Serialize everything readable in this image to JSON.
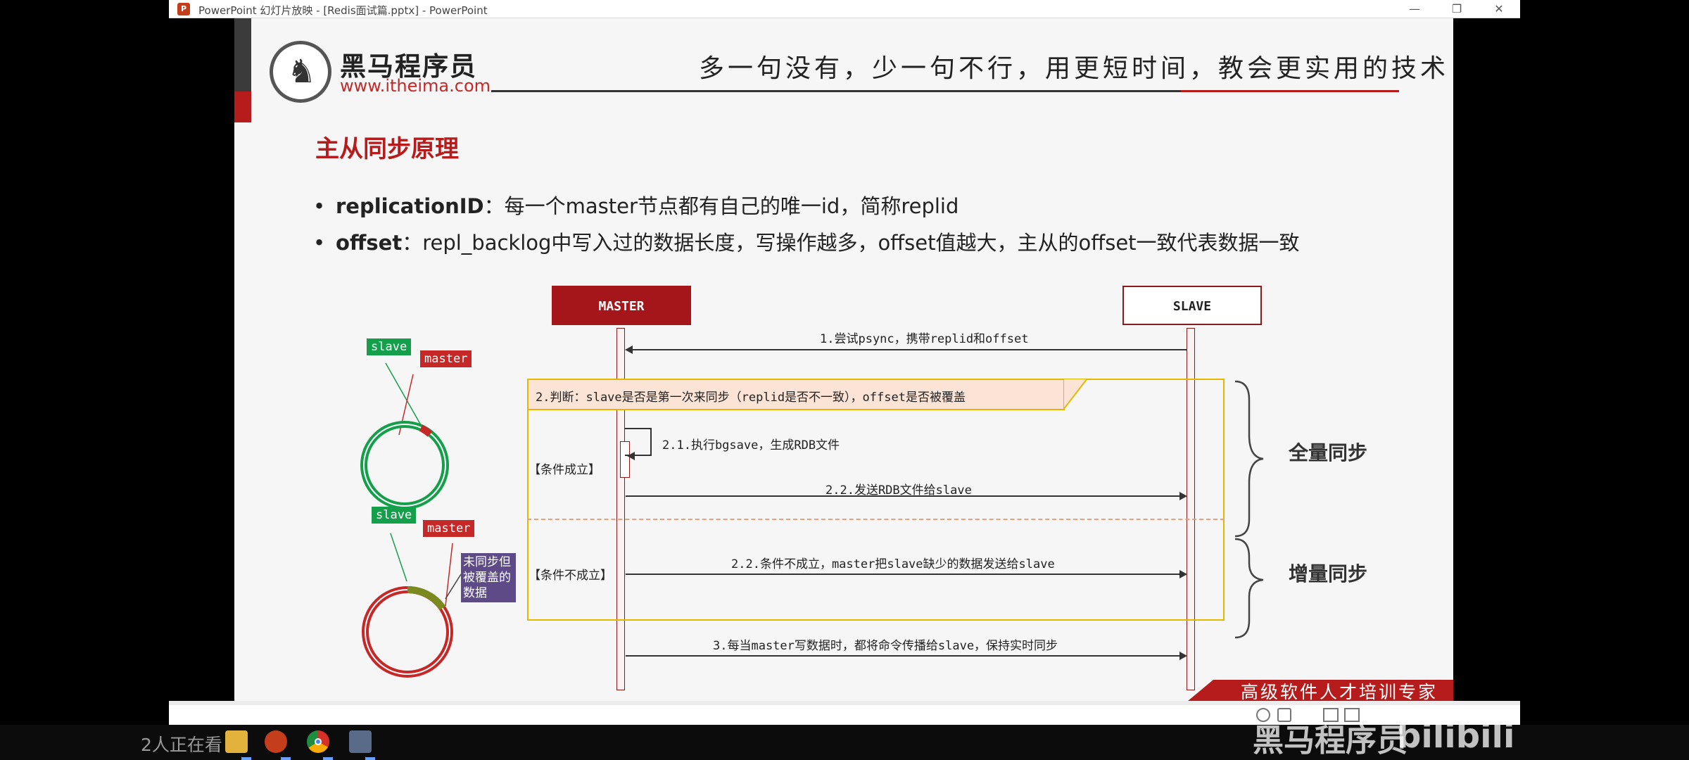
{
  "window": {
    "app_icon_letter": "P",
    "title": "PowerPoint 幻灯片放映 - [Redis面试篇.pptx] - PowerPoint",
    "minimize": "—",
    "restore": "❐",
    "close": "✕"
  },
  "header": {
    "logo_name": "黑马程序员",
    "logo_url": "www.itheima.com",
    "slogan": "多一句没有，少一句不行，用更短时间，教会更实用的技术！"
  },
  "slide": {
    "title": "主从同步原理",
    "bullets": [
      {
        "term": "replicationID",
        "text": "：每一个master节点都有自己的唯一id，简称replid"
      },
      {
        "term": "offset",
        "text": "：repl_backlog中写入过的数据长度，写操作越多，offset值越大，主从的offset一致代表数据一致"
      }
    ]
  },
  "diagram": {
    "master_label": "MASTER",
    "slave_label": "SLAVE",
    "msg1": "1.尝试psync，携带replid和offset",
    "alt_header": "2.判断：slave是否是第一次来同步（replid是否不一致），offset是否被覆盖",
    "msg21": "2.1.执行bgsave，生成RDB文件",
    "cond_true": "【条件成立】",
    "msg22a": "2.2.发送RDB文件给slave",
    "cond_false": "【条件不成立】",
    "msg22b": "2.2.条件不成立，master把slave缺少的数据发送给slave",
    "msg3": "3.每当master写数据时，都将命令传播给slave，保持实时同步",
    "full_sync": "全量同步",
    "incr_sync": "增量同步"
  },
  "rings": {
    "ring1_slave_tag": "slave",
    "ring1_master_tag": "master",
    "ring2_slave_tag": "slave",
    "ring2_master_tag": "master",
    "ring2_note": "未同步但被覆盖的数据"
  },
  "footer": {
    "tagline": "高级软件人才培训专家"
  },
  "taskbar": {
    "viewers": "2人正在看",
    "watermark": "黑马程序员",
    "bili": "bilibili"
  },
  "colors": {
    "brand_red": "#b71c1c",
    "slave_green": "#14a04a",
    "master_red": "#c62828",
    "frame_yellow": "#e5b800",
    "note_purple": "#5e4a87"
  }
}
